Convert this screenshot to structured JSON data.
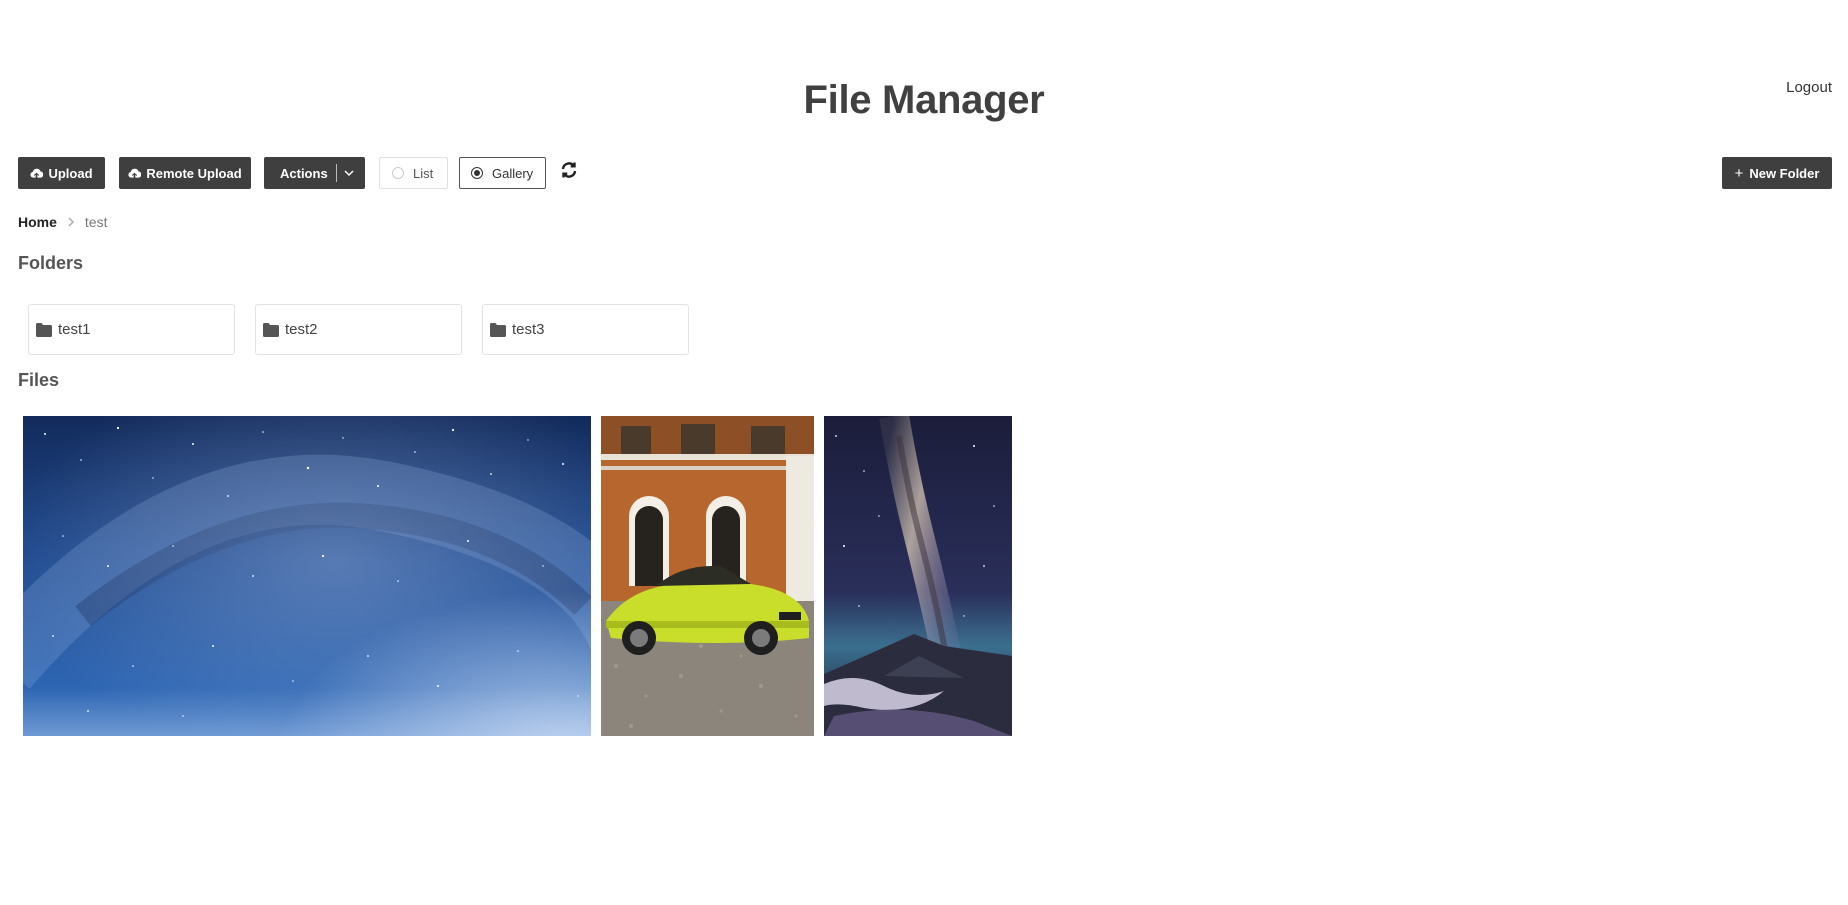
{
  "header": {
    "title": "File Manager",
    "logout_label": "Logout"
  },
  "toolbar": {
    "upload_label": "Upload",
    "remote_upload_label": "Remote Upload",
    "actions_label": "Actions",
    "view_list_label": "List",
    "view_gallery_label": "Gallery",
    "selected_view": "Gallery",
    "new_folder_label": "New Folder"
  },
  "breadcrumb": {
    "home": "Home",
    "current": "test"
  },
  "folders": {
    "title": "Folders",
    "items": [
      {
        "name": "test1"
      },
      {
        "name": "test2"
      },
      {
        "name": "test3"
      }
    ]
  },
  "files": {
    "title": "Files",
    "items": [
      {
        "icon": "starry-sky-photo"
      },
      {
        "icon": "yellow-car-photo"
      },
      {
        "icon": "milky-way-volcano-photo"
      }
    ]
  },
  "colors": {
    "button_dark": "#3f3f3f",
    "title": "#404040"
  }
}
